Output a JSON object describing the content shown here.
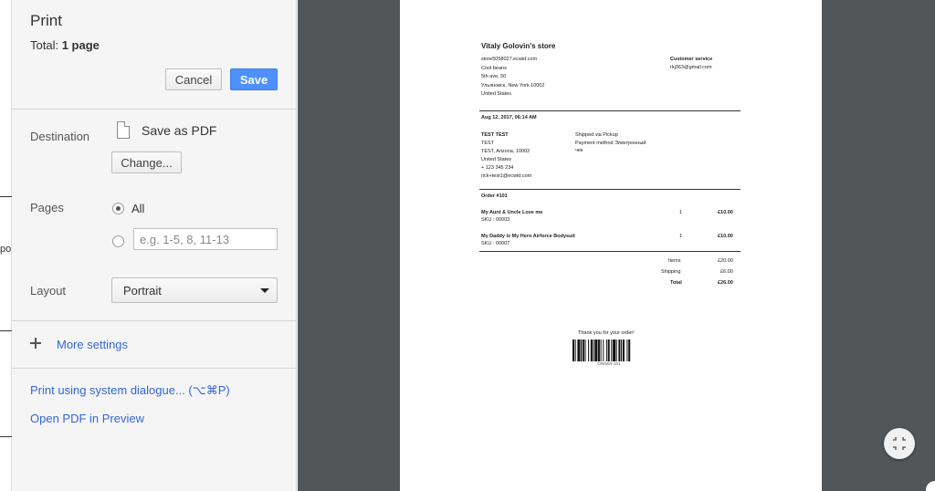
{
  "underlay": {
    "text": "ро"
  },
  "sidebar": {
    "title": "Print",
    "total_prefix": "Total: ",
    "total_value": "1 page",
    "cancel_label": "Cancel",
    "save_label": "Save",
    "destination": {
      "label": "Destination",
      "name": "Save as PDF",
      "change_label": "Change..."
    },
    "pages": {
      "label": "Pages",
      "all_label": "All",
      "all_selected": true,
      "range_placeholder": "e.g. 1-5, 8, 11-13"
    },
    "layout": {
      "label": "Layout",
      "value": "Portrait"
    },
    "more_settings": "More settings",
    "system_dialog": "Print using system dialogue... (⌥⌘P)",
    "open_preview": "Open PDF in Preview"
  },
  "receipt": {
    "store_name": "Vitaly Golovin's store",
    "store_email": "store5058027.ecwid.com",
    "store_addr": [
      "Cool beans",
      "5th ave, 50",
      "Ульяновск, New York 10002",
      "United States"
    ],
    "service_label": "Customer service",
    "service_email": "rkj363@gmail.com",
    "date": "Aug 12, 2017, 06:14 AM",
    "customer": [
      "TEST TEST",
      "TEST",
      "TEST, Arizona, 10002",
      "United States",
      "+ 123 345 234",
      "rick+test1@ecwid.com"
    ],
    "shipping": [
      "Shipped via Pickup",
      "Payment method Электронный",
      "чек"
    ],
    "order_no": "Order #101",
    "items": [
      {
        "name": "My Aunt & Uncle Love me",
        "sku": "SKU : 00003",
        "qty": "1",
        "price": "£10.00"
      },
      {
        "name": "My Daddy is My Hero Airforce Bodysuit",
        "sku": "SKU : 00007",
        "qty": "1",
        "price": "£10.00"
      }
    ],
    "totals": [
      {
        "label": "Items",
        "value": "£20.00"
      },
      {
        "label": "Shipping",
        "value": "£6.00"
      },
      {
        "label": "Total",
        "value": "£26.00"
      }
    ],
    "thanks": "Thank you for your order!",
    "barcode_caption": "ORDER-101"
  },
  "icons": [
    "pdf-file-icon",
    "plus-icon",
    "fit-to-page-icon",
    "dropdown-caret-icon"
  ],
  "colors": {
    "accent": "#4d90fe",
    "link": "#3367d6",
    "preview_bg": "#525659"
  }
}
